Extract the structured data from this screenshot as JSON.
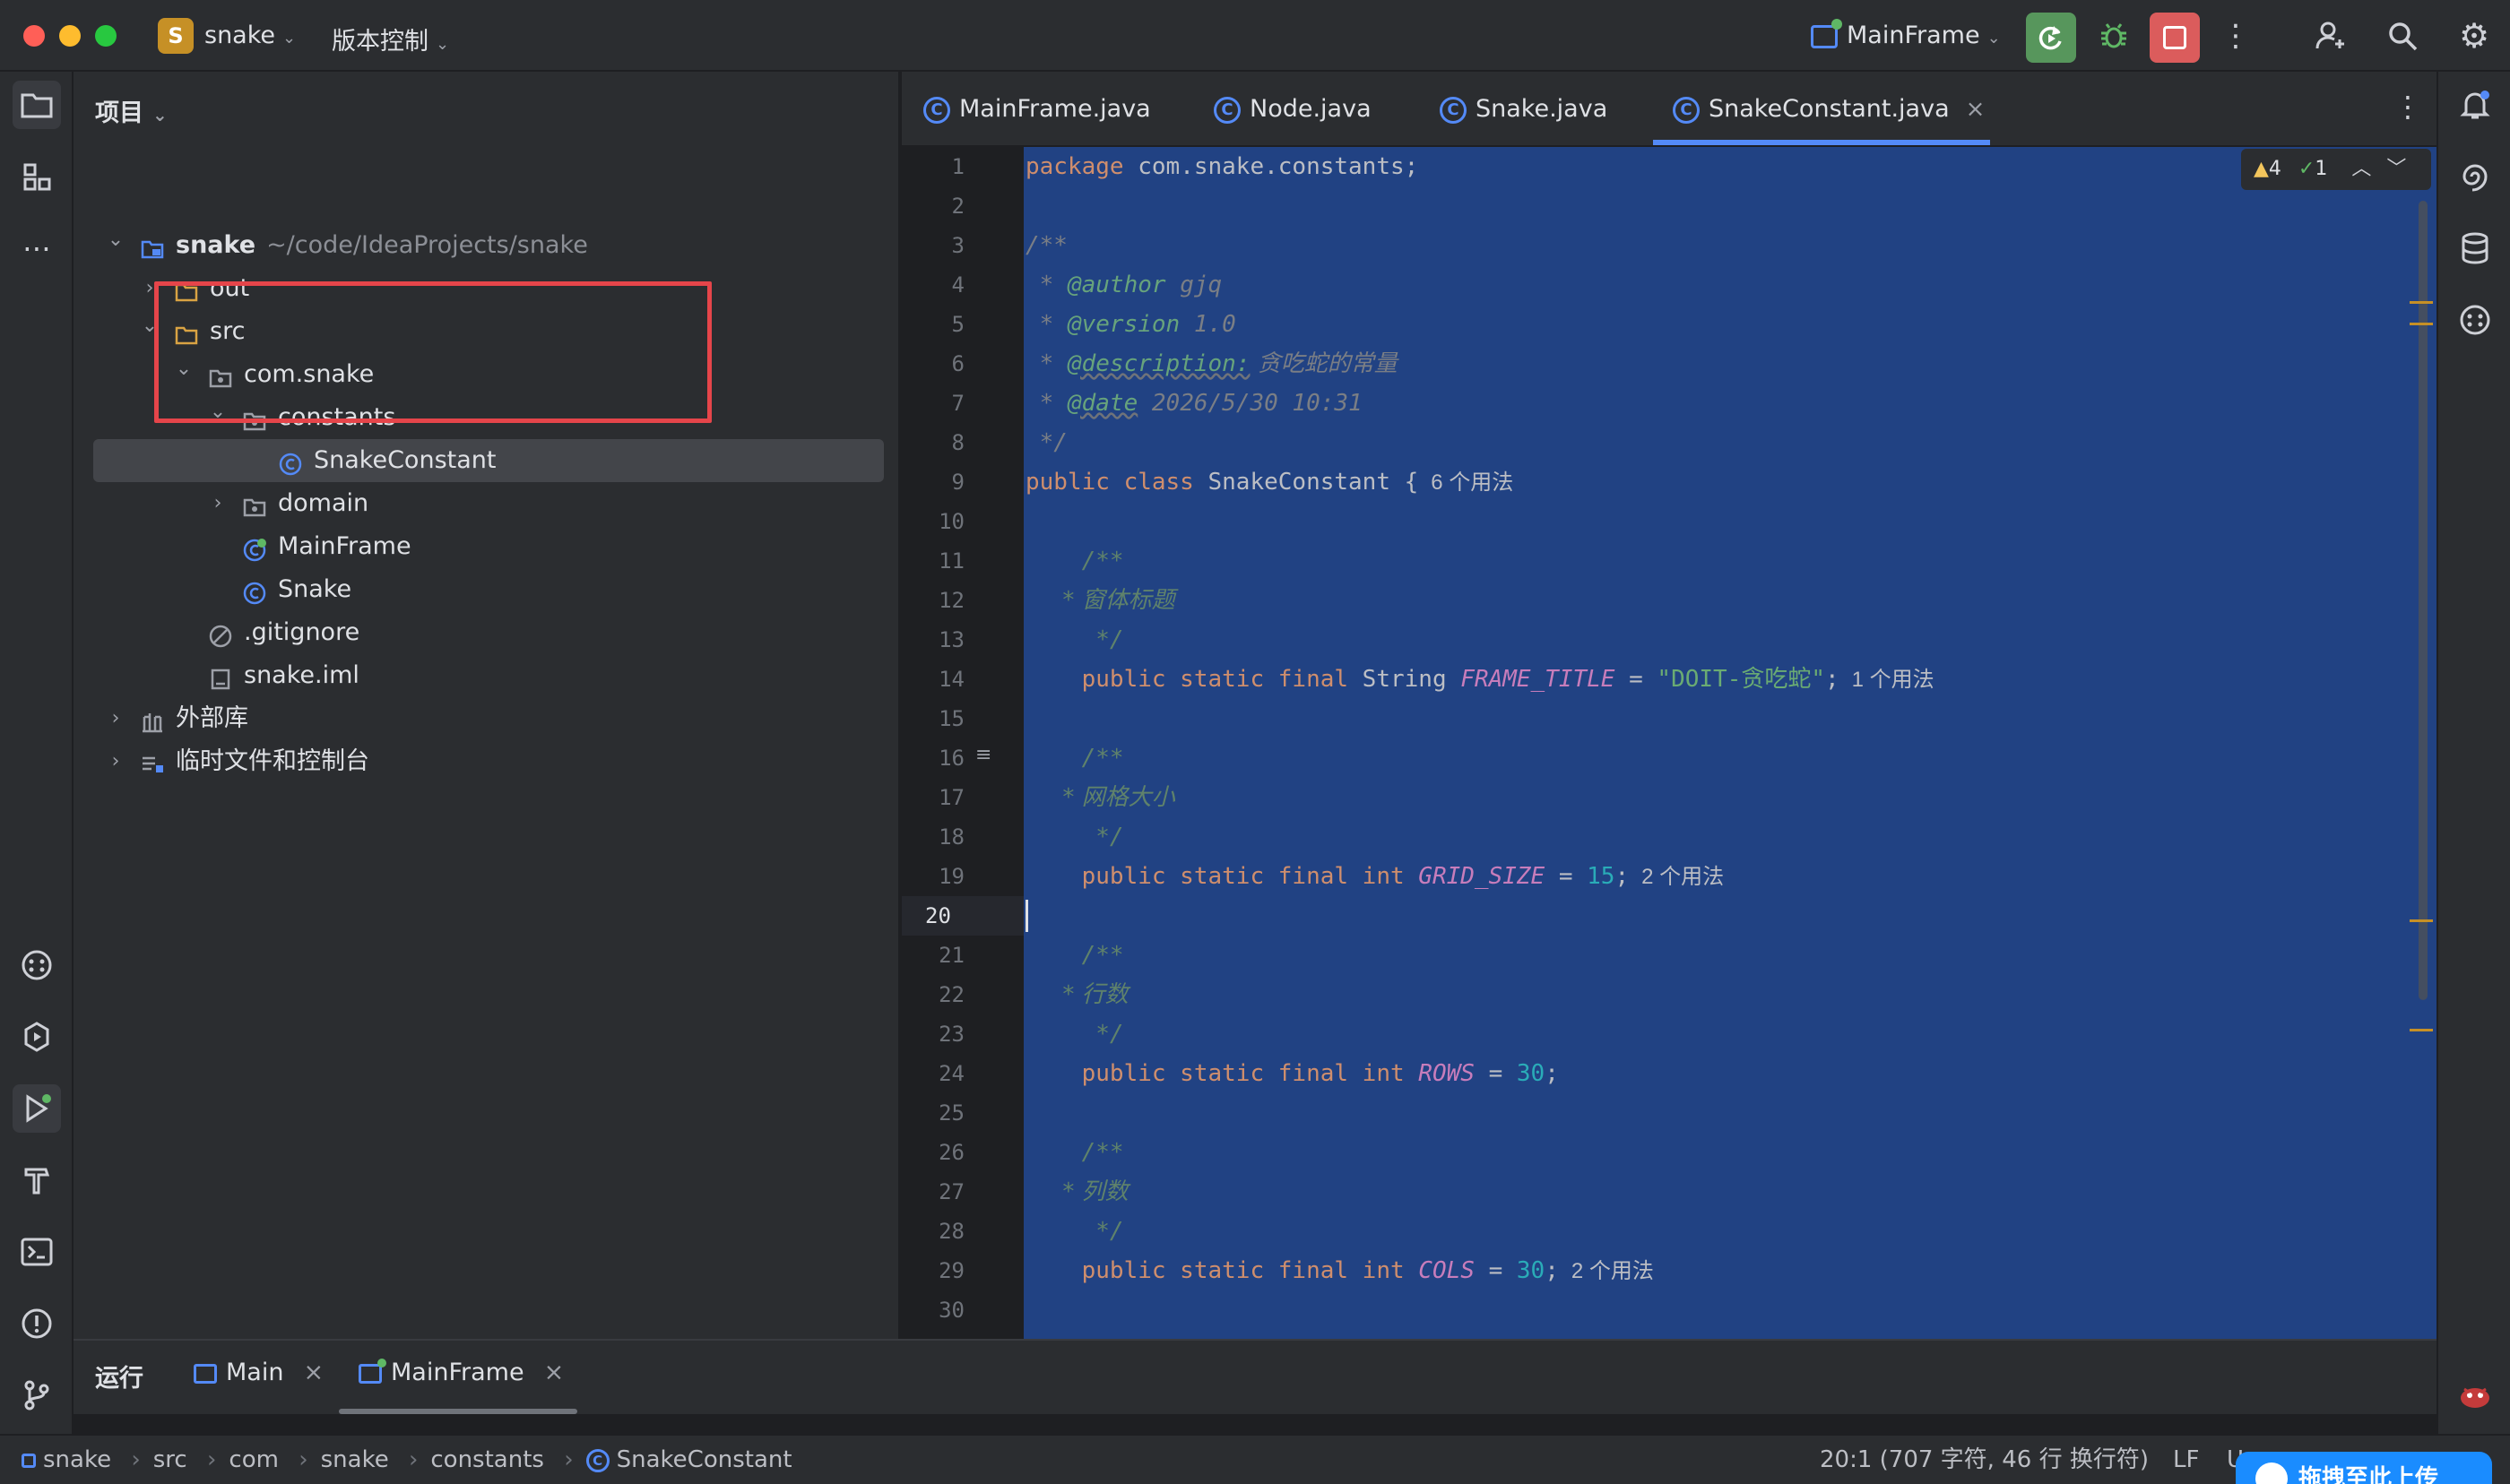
{
  "window": {
    "project_badge": "S",
    "project_name": "snake",
    "vcs_menu": "版本控制",
    "run_config": "MainFrame"
  },
  "project_panel": {
    "title": "项目",
    "tree": [
      {
        "label": "snake",
        "hint": "~/code/IdeaProjects/snake",
        "icon": "module-folder-icon",
        "expanded": true
      },
      {
        "label": "out",
        "icon": "folder-icon",
        "expanded": false
      },
      {
        "label": "src",
        "icon": "folder-icon",
        "expanded": true
      },
      {
        "label": "com.snake",
        "icon": "package-icon",
        "expanded": true
      },
      {
        "label": "constants",
        "icon": "package-icon",
        "expanded": true
      },
      {
        "label": "SnakeConstant",
        "icon": "class-icon",
        "selected": true
      },
      {
        "label": "domain",
        "icon": "package-icon",
        "expanded": false
      },
      {
        "label": "MainFrame",
        "icon": "runnable-class-icon"
      },
      {
        "label": "Snake",
        "icon": "class-icon"
      },
      {
        "label": ".gitignore",
        "icon": "ignore-file-icon"
      },
      {
        "label": "snake.iml",
        "icon": "iml-file-icon"
      },
      {
        "label": "外部库",
        "icon": "library-icon",
        "expanded": false
      },
      {
        "label": "临时文件和控制台",
        "icon": "scratch-icon",
        "expanded": false
      }
    ]
  },
  "editor": {
    "tabs": [
      {
        "label": "MainFrame.java",
        "active": false
      },
      {
        "label": "Node.java",
        "active": false
      },
      {
        "label": "Snake.java",
        "active": false
      },
      {
        "label": "SnakeConstant.java",
        "active": true
      }
    ],
    "inspections": {
      "warnings": "4",
      "checks": "1"
    },
    "caret_line": 20,
    "line_numbers": [
      "1",
      "2",
      "3",
      "4",
      "5",
      "6",
      "7",
      "8",
      "9",
      "10",
      "11",
      "12",
      "13",
      "14",
      "15",
      "16",
      "17",
      "18",
      "19",
      "20",
      "21",
      "22",
      "23",
      "24",
      "25",
      "26",
      "27",
      "28",
      "29",
      "30"
    ],
    "code": {
      "l1_kw": "package",
      "l1_rest": " com.snake.constants;",
      "l3": "/**",
      "l4_pre": " * ",
      "l4_tag": "@author",
      "l4_val": " gjq",
      "l5_pre": " * ",
      "l5_tag": "@version",
      "l5_val": " 1.0",
      "l6_pre": " * ",
      "l6_tag": "@description:",
      "l6_val": " 贪吃蛇的常量",
      "l7_pre": " * ",
      "l7_tag": "@date",
      "l7_val": " 2026/5/30 10:31",
      "l8": " */",
      "l9_kw": "public class",
      "l9_rest": " SnakeConstant {",
      "l9_usage": "6 个用法",
      "l11": "    /**",
      "l12": "     * 窗体标题",
      "l13": "     */",
      "l14_kw": "    public static final",
      "l14_type": " String ",
      "l14_field": "FRAME_TITLE",
      "l14_eq": " = ",
      "l14_str": "\"DOIT-贪吃蛇\"",
      "l14_end": ";",
      "l14_usage": "1 个用法",
      "l16": "    /**",
      "l17": "     * 网格大小",
      "l18": "     */",
      "l19_kw": "    public static final int",
      "l19_field": " GRID_SIZE",
      "l19_eq": " = ",
      "l19_num": "15",
      "l19_end": ";",
      "l19_usage": "2 个用法",
      "l21": "    /**",
      "l22": "     * 行数",
      "l23": "     */",
      "l24_kw": "    public static final int",
      "l24_field": " ROWS",
      "l24_eq": " = ",
      "l24_num": "30",
      "l24_end": ";",
      "l26": "    /**",
      "l27": "     * 列数",
      "l28": "     */",
      "l29_kw": "    public static final int",
      "l29_field": " COLS",
      "l29_eq": " = ",
      "l29_num": "30",
      "l29_end": ";",
      "l29_usage": "2 个用法"
    }
  },
  "run_panel": {
    "title": "运行",
    "tabs": [
      {
        "label": "Main"
      },
      {
        "label": "MainFrame"
      }
    ]
  },
  "status_bar": {
    "breadcrumbs": [
      "snake",
      "src",
      "com",
      "snake",
      "constants",
      "SnakeConstant"
    ],
    "position": "20:1 (707 字符, 46 行 换行符)",
    "line_separator": "LF",
    "encoding_partial": "U",
    "upload_overlay": "拖拽至此上传"
  },
  "colors": {
    "accent": "#548af7",
    "selection": "#214283",
    "highlight_box": "#e5454a",
    "run_green": "#57965c",
    "stop_red": "#db5c5c"
  }
}
